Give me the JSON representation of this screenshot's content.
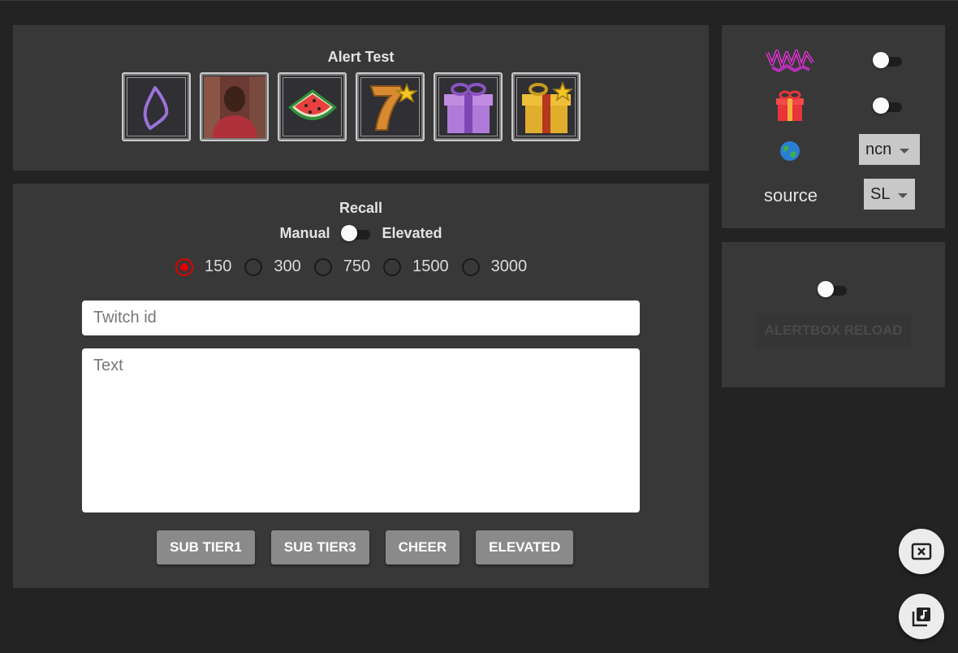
{
  "alert_test": {
    "title": "Alert Test",
    "tiles": [
      {
        "icon": "crystal-outline-icon"
      },
      {
        "icon": "person-photo-thumbnail"
      },
      {
        "icon": "watermelon-icon"
      },
      {
        "icon": "lucky-seven-icon"
      },
      {
        "icon": "purple-gift-icon"
      },
      {
        "icon": "gold-gift-icon"
      }
    ]
  },
  "recall": {
    "title": "Recall",
    "mode_left": "Manual",
    "mode_right": "Elevated",
    "amounts": [
      "150",
      "300",
      "750",
      "1500",
      "3000"
    ],
    "selected_amount": "150",
    "twitch_id_placeholder": "Twitch id",
    "text_placeholder": "Text",
    "buttons": {
      "sub_tier1": "SUB TIER1",
      "sub_tier3": "SUB TIER3",
      "cheer": "CHEER",
      "elevated": "ELEVATED"
    }
  },
  "side": {
    "logo_icon": "pink-graffiti-logo",
    "gift_icon": "red-gift-icon",
    "globe_icon": "globe-icon",
    "region_value": "ncn",
    "source_label": "source",
    "source_value": "SL",
    "alertbox_reload": "ALERTBOX RELOAD"
  },
  "fabs": {
    "close_icon": "close-box-icon",
    "music_icon": "music-library-icon"
  },
  "colors": {
    "background": "#232323",
    "panel": "#383838",
    "accent_red": "#e30000",
    "button_gray": "#8a8a8a"
  }
}
